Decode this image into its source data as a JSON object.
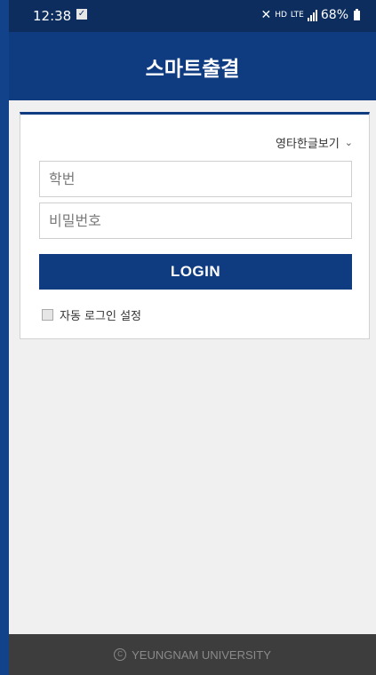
{
  "status_bar": {
    "time": "12:38",
    "notification_icon": "check-box-icon",
    "network_hd": "HD",
    "network_lte": "LTE",
    "battery": "68%"
  },
  "app_bar": {
    "title": "스마트출결"
  },
  "login_card": {
    "language_toggle": "영타한글보기",
    "student_id_placeholder": "학번",
    "password_placeholder": "비밀번호",
    "login_button": "LOGIN",
    "auto_login_label": "자동 로그인 설정",
    "auto_login_checked": false
  },
  "footer": {
    "copyright_icon": "copyright-icon",
    "text": "YEUNGNAM UNIVERSITY"
  },
  "colors": {
    "primary": "#0f3c80",
    "status_bar": "#0c2d5e",
    "background": "#f0f0f0",
    "footer": "#3d3d3d"
  }
}
